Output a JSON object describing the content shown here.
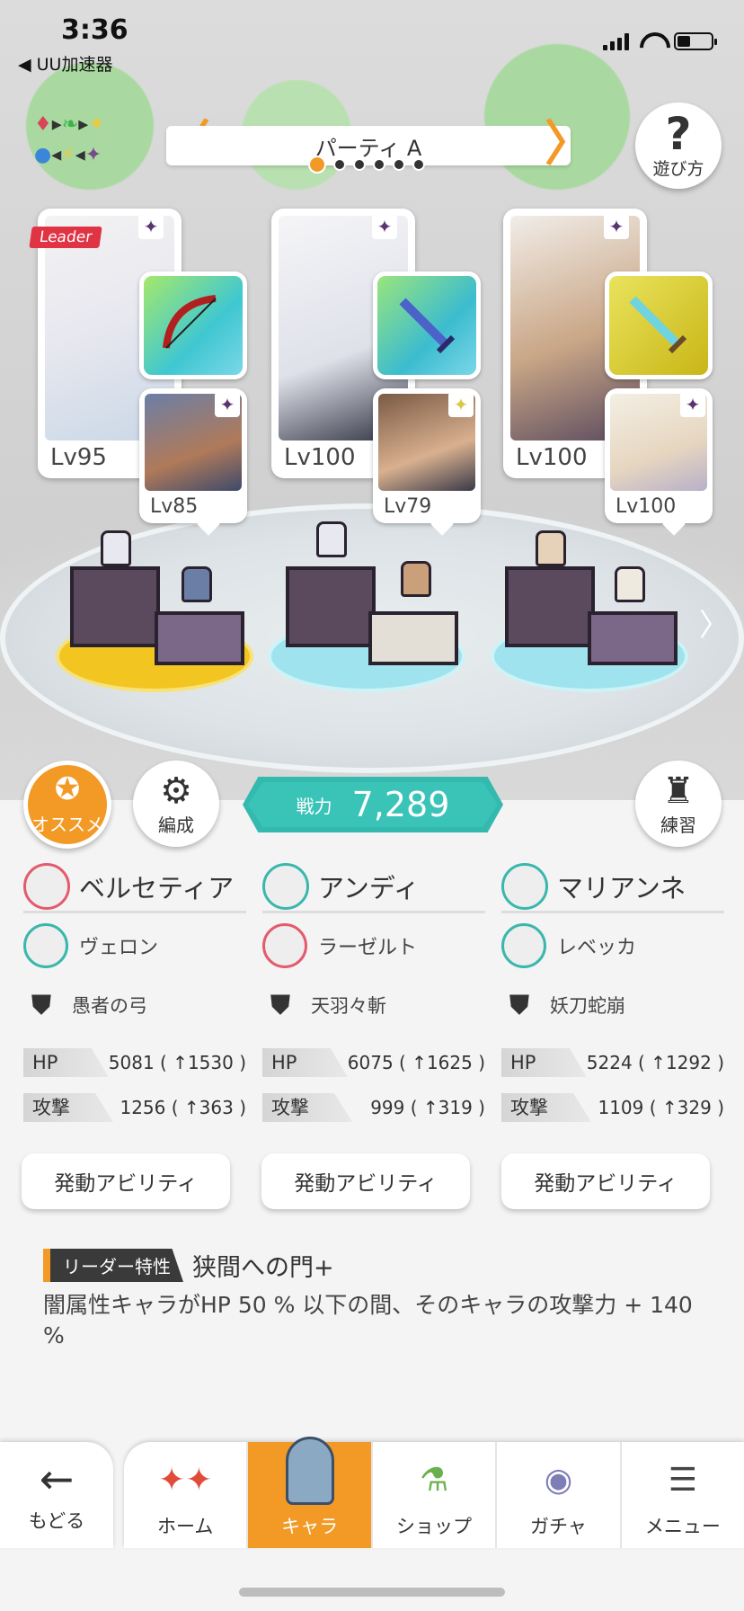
{
  "status_bar": {
    "time": "3:36",
    "back_app": "◀ UU加速器"
  },
  "party": {
    "title": "パーティ A",
    "prev_arrow": "〈",
    "next_arrow": "〉",
    "page_count": 6,
    "current_page": 1
  },
  "help_button": {
    "label": "遊び方"
  },
  "leader_tag": "Leader",
  "characters": [
    {
      "main_level": "Lv95",
      "sub_level": "Lv85",
      "name": "ベルセティア",
      "sub_name": "ヴェロン",
      "weapon": "愚者の弓",
      "hp": "5081 ( ↑1530 )",
      "atk": "1256 ( ↑363 )"
    },
    {
      "main_level": "Lv100",
      "sub_level": "Lv79",
      "name": "アンディ",
      "sub_name": "ラーゼルト",
      "weapon": "天羽々斬",
      "hp": "6075 ( ↑1625 )",
      "atk": "999 ( ↑319 )"
    },
    {
      "main_level": "Lv100",
      "sub_level": "Lv100",
      "name": "マリアンネ",
      "sub_name": "レベッカ",
      "weapon": "妖刀蛇崩",
      "hp": "5224 ( ↑1292 )",
      "atk": "1109 ( ↑329 )"
    }
  ],
  "stat_labels": {
    "hp": "HP",
    "atk": "攻撃"
  },
  "ability_button": "発動アビリティ",
  "actions": {
    "recommend": "オススメ",
    "formation": "編成",
    "practice": "練習"
  },
  "power": {
    "label": "戦力",
    "value": "7,289"
  },
  "leader_skill": {
    "tag": "リーダー特性",
    "name": "狭間への門+",
    "description": "闇属性キャラがHP 50 % 以下の間、そのキャラの攻撃力 + 140 %"
  },
  "nav": {
    "back": "もどる",
    "items": [
      {
        "label": "ホーム",
        "icon": "home-icon"
      },
      {
        "label": "キャラ",
        "icon": "character-icon",
        "active": true
      },
      {
        "label": "ショップ",
        "icon": "shop-icon"
      },
      {
        "label": "ガチャ",
        "icon": "gacha-icon"
      },
      {
        "label": "メニュー",
        "icon": "menu-icon"
      }
    ]
  },
  "colors": {
    "accent": "#f39a26",
    "power_teal": "#3ac3b7",
    "leader_red": "#e03344"
  }
}
